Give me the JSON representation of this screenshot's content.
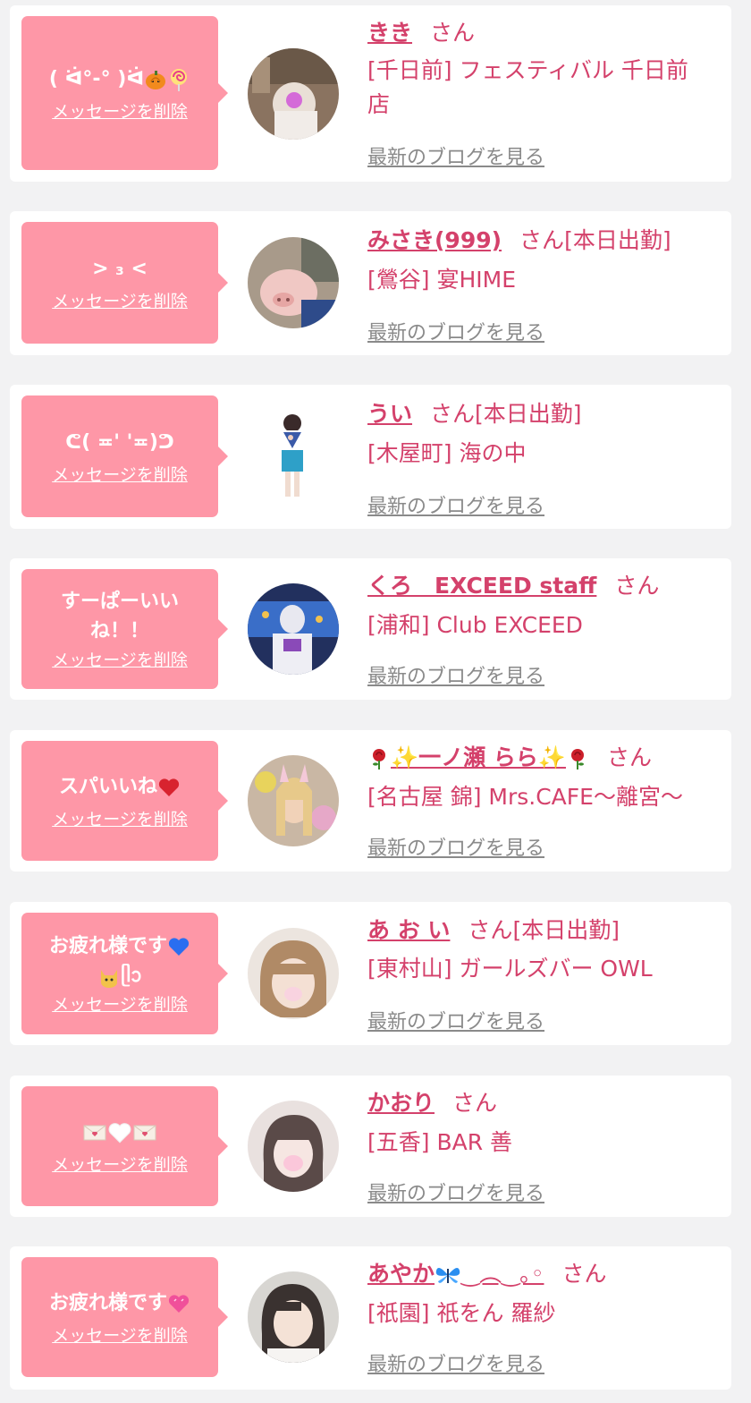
{
  "ui": {
    "delete_label": "メッセージを削除",
    "blog_label": "最新のブログを見る",
    "honorific": "さん",
    "colors": {
      "background": "#f2f2f3",
      "bubble": "#fe97a7",
      "name": "#d4416b",
      "link_gray": "#8a8a8a"
    }
  },
  "cards": [
    {
      "message": "( ᐛ°-° )ᐛ",
      "message_icons": [
        "pumpkin-icon",
        "lollipop-icon"
      ],
      "name": "きき",
      "status": "",
      "shop": "[千日前] フェスティバル 千日前店"
    },
    {
      "message": ">  ₃ <",
      "message_icons": [],
      "name": "みさき(999)",
      "status": "[本日出勤]",
      "shop": "[鶯谷] 宴HIME"
    },
    {
      "message": "ᕦ( ≖' '≖)ᕤ",
      "message_icons": [],
      "name": "うい",
      "status": "[本日出勤]",
      "shop": "[木屋町] 海の中"
    },
    {
      "message": "すーぱーいいね！！",
      "message_icons": [],
      "name": "くろ　EXCEED staff",
      "status": "",
      "shop": "[浦和] Club EXCEED"
    },
    {
      "message": "スパいいね",
      "message_icons": [
        "red-heart-icon"
      ],
      "name": "✨一ノ瀬 らら✨",
      "name_icons": [
        "rose-icon",
        "rose-icon"
      ],
      "status": "",
      "shop": "[名古屋 錦] Mrs.CAFE〜離宮〜"
    },
    {
      "message": "お疲れ様です",
      "message_line2": "ᥫᩣ",
      "message_icons": [
        "blue-heart-icon",
        "cat-face-icon"
      ],
      "name": "あ お い",
      "status": "[本日出勤]",
      "shop": "[東村山] ガールズバー OWL"
    },
    {
      "message": "",
      "message_icons": [
        "love-letter-icon",
        "white-heart-icon",
        "love-letter-icon"
      ],
      "name": "かおり",
      "status": "",
      "shop": "[五香] BAR 善"
    },
    {
      "message": "お疲れ様です",
      "message_icons": [
        "pink-heart-icon"
      ],
      "name": "あやか",
      "name_suffix": "‿︵‿｡◦",
      "name_icons": [
        "butterfly-icon"
      ],
      "status": "",
      "shop": "[祇園] 祇をん 羅紗"
    }
  ]
}
